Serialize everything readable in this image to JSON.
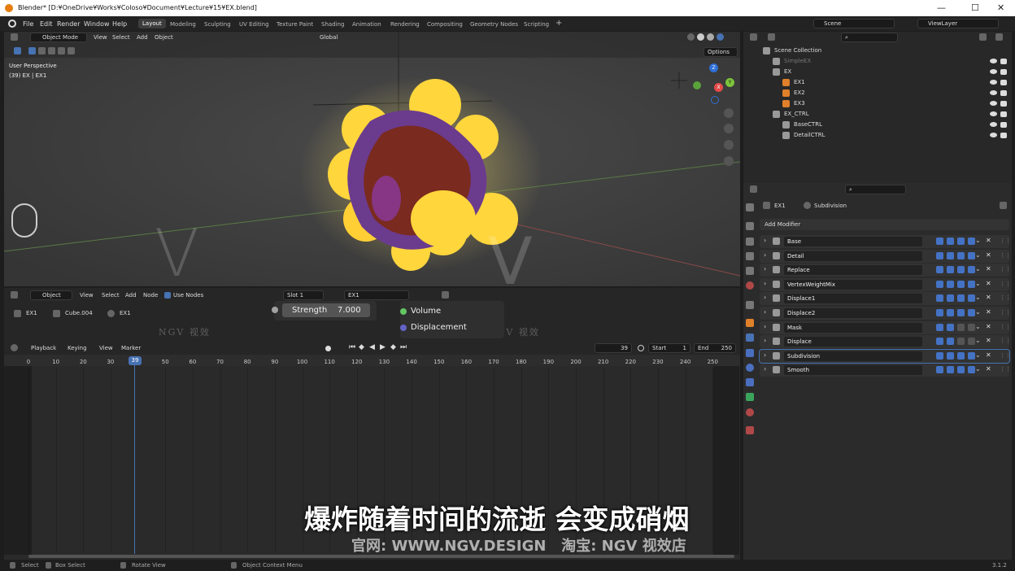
{
  "window": {
    "title": "Blender* [D:¥OneDrive¥Works¥Coloso¥Document¥Lecture¥15¥EX.blend]"
  },
  "menu": [
    "File",
    "Edit",
    "Render",
    "Window",
    "Help"
  ],
  "workspaces": [
    "Layout",
    "Modeling",
    "Sculpting",
    "UV Editing",
    "Texture Paint",
    "Shading",
    "Animation",
    "Rendering",
    "Compositing",
    "Geometry Nodes",
    "Scripting"
  ],
  "active_workspace": "Layout",
  "scene": "Scene",
  "view_layer": "ViewLayer",
  "viewport": {
    "mode": "Object Mode",
    "menus": [
      "View",
      "Select",
      "Add",
      "Object"
    ],
    "transform": "Global",
    "options": "Options",
    "perspective": "User Perspective",
    "object_info": "(39) EX | EX1",
    "gizmo": {
      "x": "X",
      "y": "Y",
      "z": "Z"
    }
  },
  "node_editor": {
    "type": "Object",
    "menus": [
      "View",
      "Select",
      "Add",
      "Node"
    ],
    "use_nodes": "Use Nodes",
    "slot": "Slot 1",
    "material": "EX1",
    "breadcrumb": [
      "EX1",
      "Cube.004",
      "EX1"
    ],
    "strength_label": "Strength",
    "strength_value": "7.000",
    "outputs": [
      "Volume",
      "Displacement"
    ]
  },
  "timeline": {
    "menus": [
      "Playback",
      "Keying",
      "View",
      "Marker"
    ],
    "current_frame": "39",
    "start_label": "Start",
    "start": "1",
    "end_label": "End",
    "end": "250",
    "ticks": [
      "0",
      "10",
      "20",
      "30",
      "39",
      "50",
      "60",
      "70",
      "80",
      "90",
      "100",
      "110",
      "120",
      "130",
      "140",
      "150",
      "160",
      "170",
      "180",
      "190",
      "200",
      "210",
      "220",
      "230",
      "240",
      "250"
    ]
  },
  "outliner": {
    "rows": [
      {
        "label": "Scene Collection",
        "indent": 0
      },
      {
        "label": "SimpleEX",
        "indent": 1,
        "dim": true
      },
      {
        "label": "EX",
        "indent": 1
      },
      {
        "label": "EX1",
        "indent": 2
      },
      {
        "label": "EX2",
        "indent": 2
      },
      {
        "label": "EX3",
        "indent": 2
      },
      {
        "label": "EX_CTRL",
        "indent": 1
      },
      {
        "label": "BaseCTRL",
        "indent": 2
      },
      {
        "label": "DetailCTRL",
        "indent": 2
      }
    ]
  },
  "properties": {
    "breadcrumb_object": "EX1",
    "breadcrumb_modifier": "Subdivision",
    "add_modifier": "Add Modifier",
    "modifiers": [
      "Base",
      "Detail",
      "Replace",
      "VertexWeightMix",
      "Displace1",
      "Displace2",
      "Mask",
      "Displace",
      "Subdivision",
      "Smooth"
    ]
  },
  "status": {
    "select": "Select",
    "box_select": "Box Select",
    "rotate": "Rotate View",
    "context": "Object Context Menu",
    "version": "3.1.2"
  },
  "watermark": {
    "logo": "NGV 视效",
    "v": "V"
  },
  "subtitle": {
    "main": "爆炸随着时间的流逝 会变成硝烟",
    "sub": "官网: WWW.NGV.DESIGN   淘宝: NGV 视效店"
  },
  "colors": {
    "accent": "#4772b3",
    "fire": "#ffd23a",
    "purple": "#6a3fa0",
    "playhead": "#4772b3"
  }
}
